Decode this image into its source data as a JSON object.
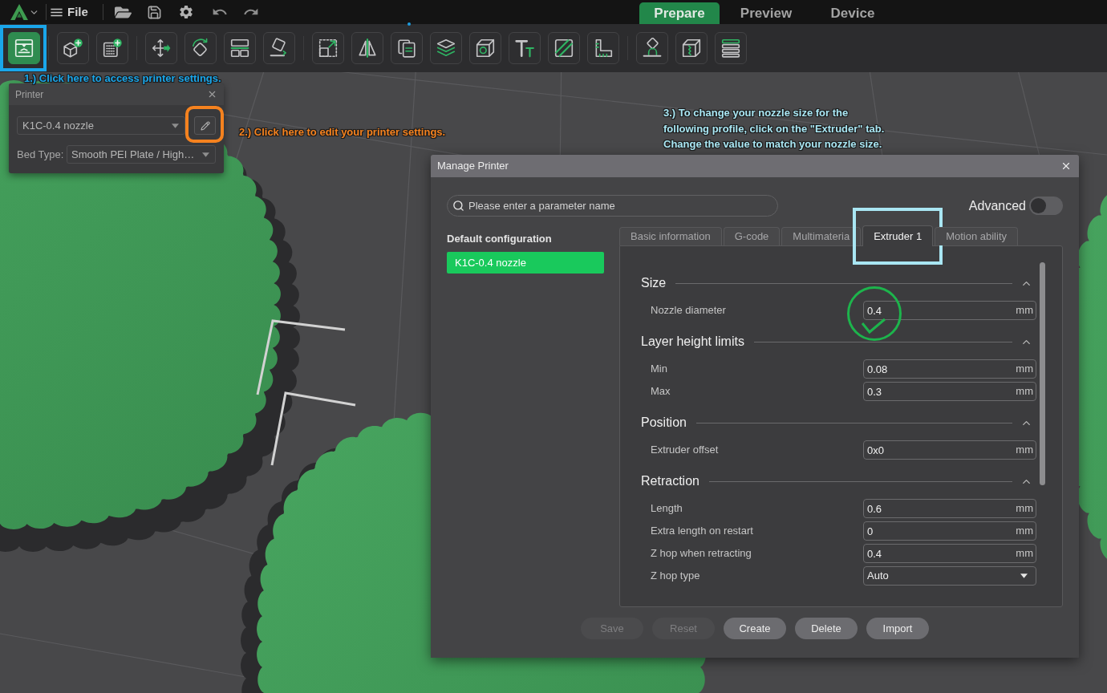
{
  "top_bar": {
    "menu_label": "File",
    "tabs": [
      {
        "label": "Prepare",
        "selected": true
      },
      {
        "label": "Preview",
        "selected": false
      },
      {
        "label": "Device",
        "selected": false
      }
    ]
  },
  "toolbar": {
    "groups": [
      [
        {
          "selected": true
        }
      ],
      [
        {
          "selected": false
        },
        {
          "selected": false
        }
      ],
      [
        {
          "selected": false
        },
        {
          "selected": false
        },
        {
          "selected": false
        },
        {
          "selected": false
        }
      ],
      [
        {
          "selected": false
        },
        {
          "selected": false
        },
        {
          "selected": false
        },
        {
          "selected": false
        },
        {
          "selected": false
        },
        {
          "selected": false
        },
        {
          "selected": false
        },
        {
          "selected": false
        }
      ],
      [
        {
          "selected": false
        },
        {
          "selected": false
        },
        {
          "selected": false
        }
      ]
    ]
  },
  "annotations": [
    {
      "text": "1.) Click here to access printer settings.",
      "color": "#1aa6ea"
    },
    {
      "text": "2.) Click here to edit your printer settings.",
      "color": "#f5821f"
    },
    {
      "text": "3.) To change your nozzle size for the\nfollowing profile, click on the \"Extruder\" tab.\nChange the value to match your nozzle size.",
      "color": "#a9e6f3"
    }
  ],
  "printer_panel": {
    "title": "Printer",
    "printer": "K1C-0.4 nozzle",
    "bed_type_label": "Bed Type:",
    "bed_type": "Smooth PEI Plate / High…"
  },
  "dialog": {
    "title": "Manage Printer",
    "search": {
      "placeholder": "Please enter a parameter name"
    },
    "advanced": {
      "label": "Advanced",
      "on": false
    },
    "presets": {
      "heading": "Default configuration",
      "items": [
        {
          "label": "K1C-0.4 nozzle",
          "selected": true
        }
      ]
    },
    "tabs": [
      {
        "label": "Basic information",
        "selected": false
      },
      {
        "label": "G-code",
        "selected": false
      },
      {
        "label": "Multimateria",
        "selected": false
      },
      {
        "label": "Extruder 1",
        "selected": true
      },
      {
        "label": "Motion ability",
        "selected": false
      }
    ],
    "sections": [
      {
        "title": "Size",
        "expanded": true,
        "fields": [
          {
            "kind": "number",
            "label": "Nozzle diameter",
            "value": "0.4",
            "unit": "mm"
          }
        ]
      },
      {
        "title": "Layer height limits",
        "expanded": true,
        "fields": [
          {
            "kind": "number",
            "label": "Min",
            "value": "0.08",
            "unit": "mm"
          },
          {
            "kind": "number",
            "label": "Max",
            "value": "0.3",
            "unit": "mm"
          }
        ]
      },
      {
        "title": "Position",
        "expanded": true,
        "fields": [
          {
            "kind": "number",
            "label": "Extruder offset",
            "value": "0x0",
            "unit": "mm"
          }
        ]
      },
      {
        "title": "Retraction",
        "expanded": true,
        "fields": [
          {
            "kind": "number",
            "label": "Length",
            "value": "0.6",
            "unit": "mm"
          },
          {
            "kind": "number",
            "label": "Extra length on restart",
            "value": "0",
            "unit": "mm"
          },
          {
            "kind": "number",
            "label": "Z hop when retracting",
            "value": "0.4",
            "unit": "mm"
          },
          {
            "kind": "select",
            "label": "Z hop type",
            "value": "Auto"
          }
        ]
      }
    ],
    "buttons": [
      {
        "label": "Save",
        "disabled": true
      },
      {
        "label": "Reset",
        "disabled": true
      },
      {
        "label": "Create",
        "disabled": false
      },
      {
        "label": "Delete",
        "disabled": false
      },
      {
        "label": "Import",
        "disabled": false
      }
    ]
  }
}
